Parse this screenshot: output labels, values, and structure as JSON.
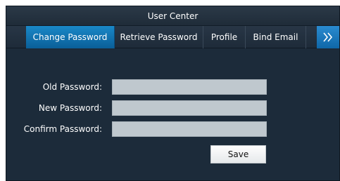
{
  "window": {
    "title": "User Center"
  },
  "tabs": [
    {
      "label": "Change Password",
      "active": true
    },
    {
      "label": "Retrieve Password",
      "active": false
    },
    {
      "label": "Profile",
      "active": false
    },
    {
      "label": "Bind Email",
      "active": false
    }
  ],
  "tabs_more_icon": "double-chevron-right-icon",
  "form": {
    "old_password": {
      "label": "Old Password:",
      "value": ""
    },
    "new_password": {
      "label": "New Password:",
      "value": ""
    },
    "confirm_password": {
      "label": "Confirm Password:",
      "value": ""
    },
    "save_label": "Save"
  },
  "colors": {
    "background": "#1c2b3a",
    "active_tab": "#1a88c8",
    "input_fill": "#bfc8ce",
    "text": "#ffffff"
  }
}
